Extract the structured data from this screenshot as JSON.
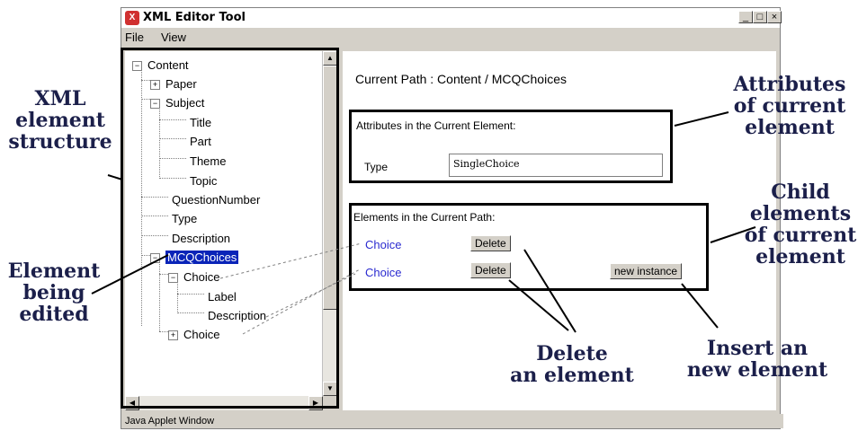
{
  "window": {
    "title": "XML Editor Tool",
    "min": "_",
    "max": "□",
    "close": "×"
  },
  "menu": [
    "File",
    "View"
  ],
  "tree": {
    "content": "Content",
    "paper": "Paper",
    "subject": "Subject",
    "title": "Title",
    "part": "Part",
    "theme": "Theme",
    "topic": "Topic",
    "question_number": "QuestionNumber",
    "type": "Type",
    "description": "Description",
    "mcq": "MCQChoices",
    "choice1": "Choice",
    "label": "Label",
    "description2": "Description",
    "choice2": "Choice"
  },
  "editor": {
    "current_path": "Current Path : Content / MCQChoices",
    "attributes_header": "Attributes in the Current Element:",
    "attr_name": "Type",
    "attr_value": "SingleChoice",
    "elements_header": "Elements in the Current Path:",
    "children": [
      {
        "name": "Choice",
        "delete_label": "Delete"
      },
      {
        "name": "Choice",
        "delete_label": "Delete"
      }
    ],
    "new_instance_label": "new instance"
  },
  "status": "Java Applet Window",
  "annotations": {
    "xml_structure": "XML\nelement\nstructure",
    "element_edited": "Element\nbeing\nedited",
    "attributes": "Attributes\nof current\nelement",
    "child_elements": "Child\nelements\nof current\nelement",
    "delete": "Delete\nan element",
    "insert": "Insert an\nnew element"
  },
  "colors": {
    "selection": "#0a24b8",
    "child_link": "#2a2ad0",
    "annotation": "#1b1f4a"
  }
}
